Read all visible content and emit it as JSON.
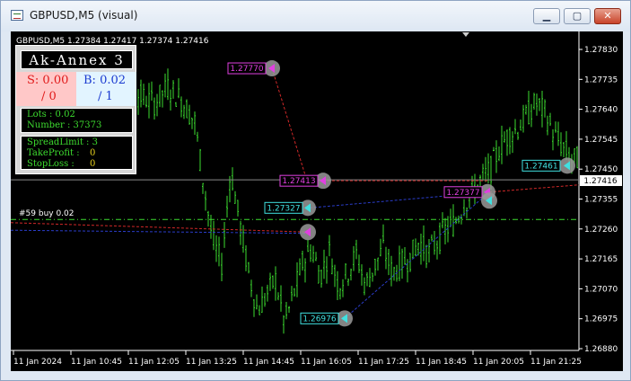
{
  "window": {
    "title": "GBPUSD,M5 (visual)",
    "buttons": {
      "minimize": "▁",
      "maximize": "▢",
      "close": "✕"
    }
  },
  "chart": {
    "info": "GBPUSD,M5  1.27384 1.27417 1.27374 1.27416",
    "position_label": "#59 buy 0.02",
    "current_price": "1.27416",
    "price_ticks": [
      "1.27830",
      "1.27735",
      "1.27640",
      "1.27545",
      "1.27450",
      "1.27355",
      "1.27260",
      "1.27165",
      "1.27070",
      "1.26975",
      "1.26880"
    ],
    "time_ticks": [
      "11 Jan 2024",
      "11 Jan 10:45",
      "11 Jan 12:05",
      "11 Jan 13:25",
      "11 Jan 14:45",
      "11 Jan 16:05",
      "11 Jan 17:25",
      "11 Jan 18:45",
      "11 Jan 20:05",
      "11 Jan 21:25"
    ],
    "trade_labels": [
      {
        "text": "1.27770",
        "kind": "sell",
        "price": 1.2777
      },
      {
        "text": "1.27413",
        "kind": "sell",
        "price": 1.27413
      },
      {
        "text": "1.27327",
        "kind": "buy",
        "price": 1.27327
      },
      {
        "text": "1.27377",
        "kind": "sell",
        "price": 1.27377
      },
      {
        "text": "1.26976",
        "kind": "buy",
        "price": 1.26976
      },
      {
        "text": "1.27461",
        "kind": "buy",
        "price": 1.27461
      }
    ],
    "colors": {
      "candle": "#3ddc2f",
      "sell_label": "#e040e0",
      "buy_label": "#40e0e0",
      "background": "#000000"
    }
  },
  "panel": {
    "name": "Ak-Annex 3",
    "sell_value": "S: 0.00",
    "sell_count": "/ 0",
    "buy_value": "B: 0.02",
    "buy_count": "/ 1",
    "lots": "Lots : 0.02",
    "number": "Number : 37373",
    "spread_limit": "SpreadLimit : 3",
    "take_profit": "TakeProfit :",
    "take_profit_value": "0",
    "stop_loss": "StopLoss :",
    "stop_loss_value": "0"
  }
}
